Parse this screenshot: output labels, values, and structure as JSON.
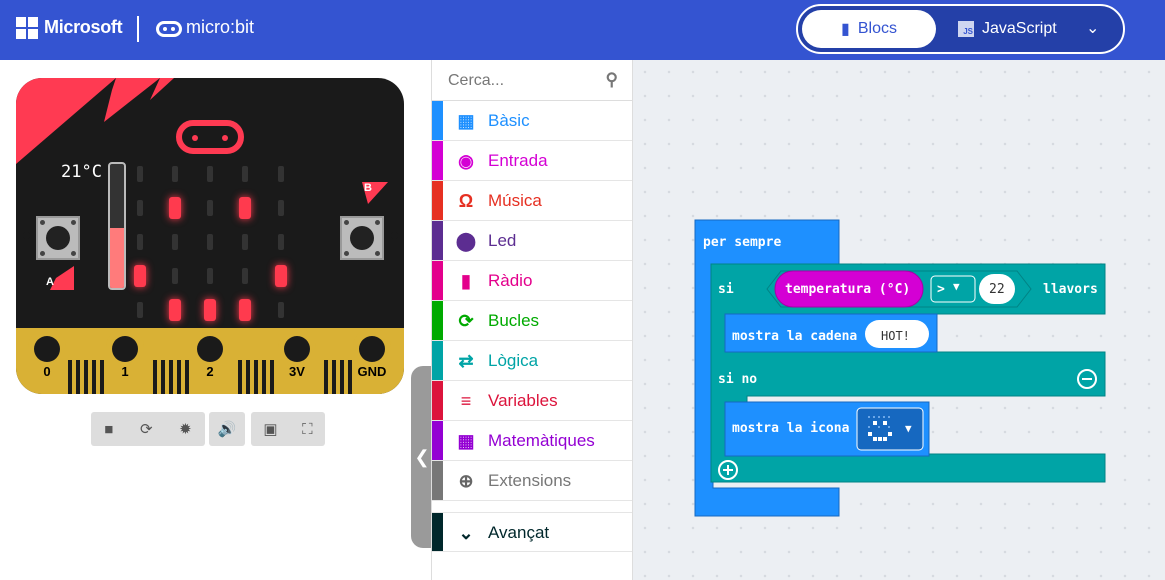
{
  "header": {
    "brand": "Microsoft",
    "product": "micro:bit",
    "tab_blocks": "Blocs",
    "tab_js": "JavaScript",
    "js_icon_text": "JS"
  },
  "simulator": {
    "temperature": "21°C",
    "button_a": "A",
    "button_b": "B",
    "pins": [
      "0",
      "1",
      "2",
      "3V",
      "GND"
    ],
    "controls": [
      "stop",
      "restart",
      "debug",
      "sound",
      "screenshot",
      "fullscreen"
    ]
  },
  "toolbox": {
    "search_placeholder": "Cerca...",
    "categories": [
      {
        "label": "Bàsic",
        "color": "#1e90ff",
        "icon": "grid-icon"
      },
      {
        "label": "Entrada",
        "color": "#d400d4",
        "icon": "circle-icon"
      },
      {
        "label": "Música",
        "color": "#e63022",
        "icon": "headphones-icon"
      },
      {
        "label": "Led",
        "color": "#5c2d91",
        "icon": "toggle-icon"
      },
      {
        "label": "Ràdio",
        "color": "#e3008c",
        "icon": "signal-icon"
      },
      {
        "label": "Bucles",
        "color": "#00aa00",
        "icon": "loop-icon"
      },
      {
        "label": "Lògica",
        "color": "#00a4a6",
        "icon": "shuffle-icon"
      },
      {
        "label": "Variables",
        "color": "#dc143c",
        "icon": "lines-icon"
      },
      {
        "label": "Matemàtiques",
        "color": "#9400d3",
        "icon": "calculator-icon"
      },
      {
        "label": "Extensions",
        "color": "#777777",
        "icon": "plus-circle-icon"
      },
      {
        "label": "Avançat",
        "color": "#00272b",
        "icon": "chevron-down-icon"
      }
    ]
  },
  "workspace": {
    "forever": "per sempre",
    "if": "si",
    "temperature": "temperatura (°C)",
    "operator": ">",
    "value": "22",
    "then": "llavors",
    "show_string": "mostra la cadena",
    "string_value": "HOT!",
    "else": "si no",
    "show_icon": "mostra la icona"
  }
}
